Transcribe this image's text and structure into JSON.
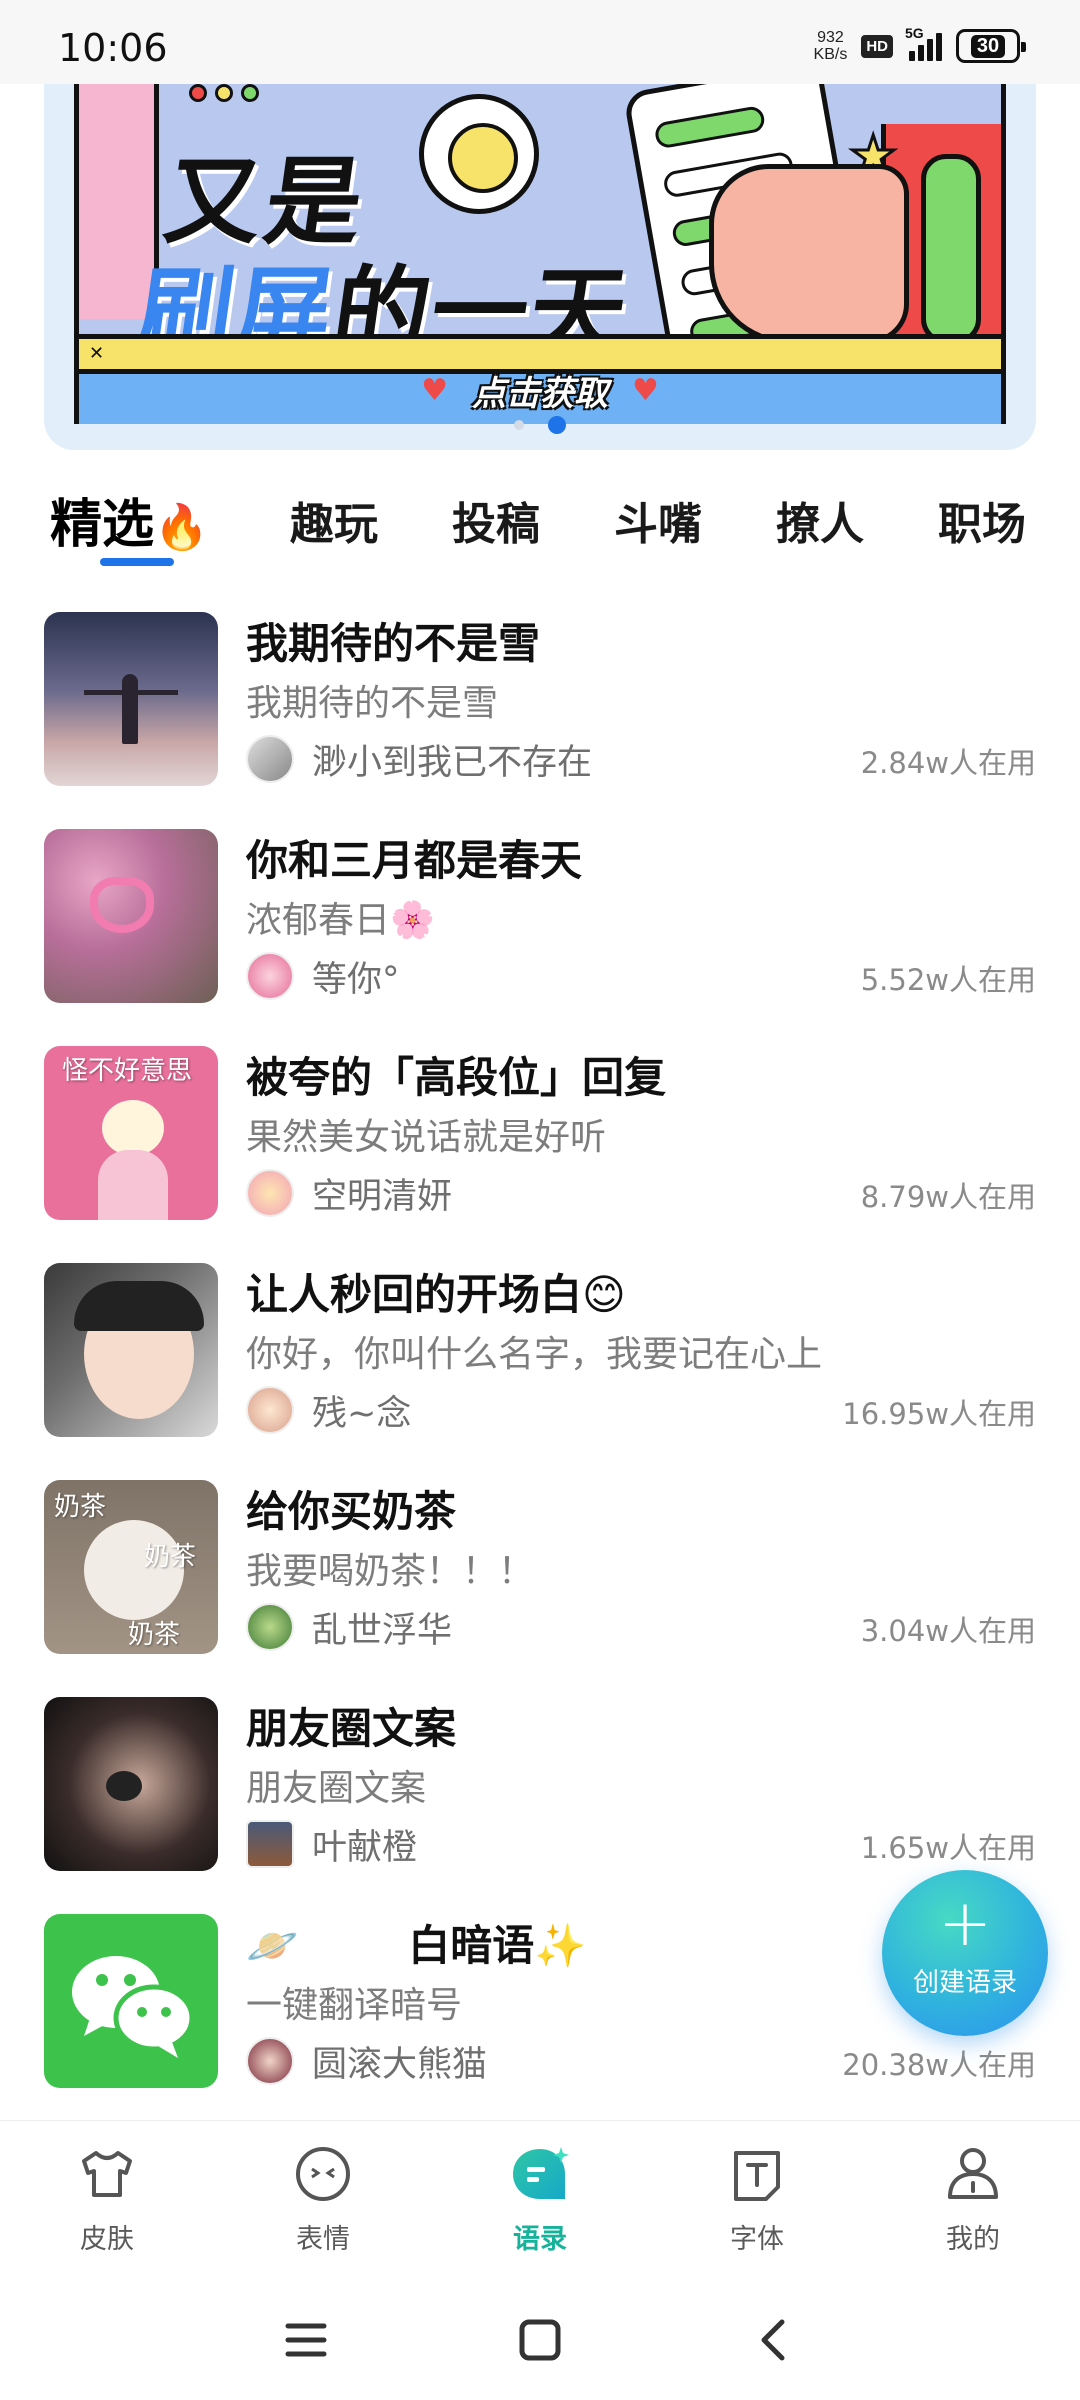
{
  "status_bar": {
    "time": "10:06",
    "net_speed_value": "932",
    "net_speed_unit": "KB/s",
    "hd": "HD",
    "network": "5G",
    "battery": "30"
  },
  "banner": {
    "line1": "又是",
    "line2_blue": "刷屏",
    "line2_black": "的一天",
    "cta": "点击获取",
    "close_label": "✕",
    "page_count": 2,
    "active_page": 2
  },
  "tabs": [
    {
      "label": "精选",
      "emoji": "🔥",
      "active": true
    },
    {
      "label": "趣玩"
    },
    {
      "label": "投稿"
    },
    {
      "label": "斗嘴"
    },
    {
      "label": "撩人"
    },
    {
      "label": "职场"
    }
  ],
  "items": [
    {
      "title": "我期待的不是雪",
      "subtitle": "我期待的不是雪",
      "author": "渺小到我已不存在",
      "users": "2.84w人在用",
      "thumb_overlay": ""
    },
    {
      "title": "你和三月都是春天",
      "subtitle": "浓郁春日🌸",
      "author": "等你°",
      "users": "5.52w人在用",
      "thumb_overlay": ""
    },
    {
      "title": "被夸的「高段位」回复",
      "subtitle": "果然美女说话就是好听",
      "author": "空明清妍",
      "users": "8.79w人在用",
      "thumb_overlay": "怪不好意思"
    },
    {
      "title": "让人秒回的开场白😊",
      "subtitle": "你好，你叫什么名字，我要记在心上",
      "author": "残~念",
      "users": "16.95w人在用",
      "thumb_overlay": ""
    },
    {
      "title": "给你买奶茶",
      "subtitle": "我要喝奶茶！！！",
      "author": "乱世浮华",
      "users": "3.04w人在用",
      "thumb_overlay": "奶茶"
    },
    {
      "title": "朋友圈文案",
      "subtitle": "朋友圈文案",
      "author": "叶献橙",
      "users": "1.65w人在用",
      "thumb_overlay": ""
    },
    {
      "title": "白暗语✨",
      "subtitle": "一键翻译暗号",
      "author": "圆滚大熊猫",
      "users": "20.38w人在用",
      "thumb_overlay": ""
    }
  ],
  "fab": {
    "plus": "+",
    "label": "创建语录"
  },
  "bottom_nav": [
    {
      "label": "皮肤",
      "icon": "tshirt-icon"
    },
    {
      "label": "表情",
      "icon": "face-icon"
    },
    {
      "label": "语录",
      "icon": "quote-bubble-icon",
      "active": true
    },
    {
      "label": "字体",
      "icon": "font-icon"
    },
    {
      "label": "我的",
      "icon": "person-icon"
    }
  ],
  "colors": {
    "accent_blue": "#1e73e8",
    "active_green": "#17b29a",
    "text_gray": "#7d7d7d"
  }
}
